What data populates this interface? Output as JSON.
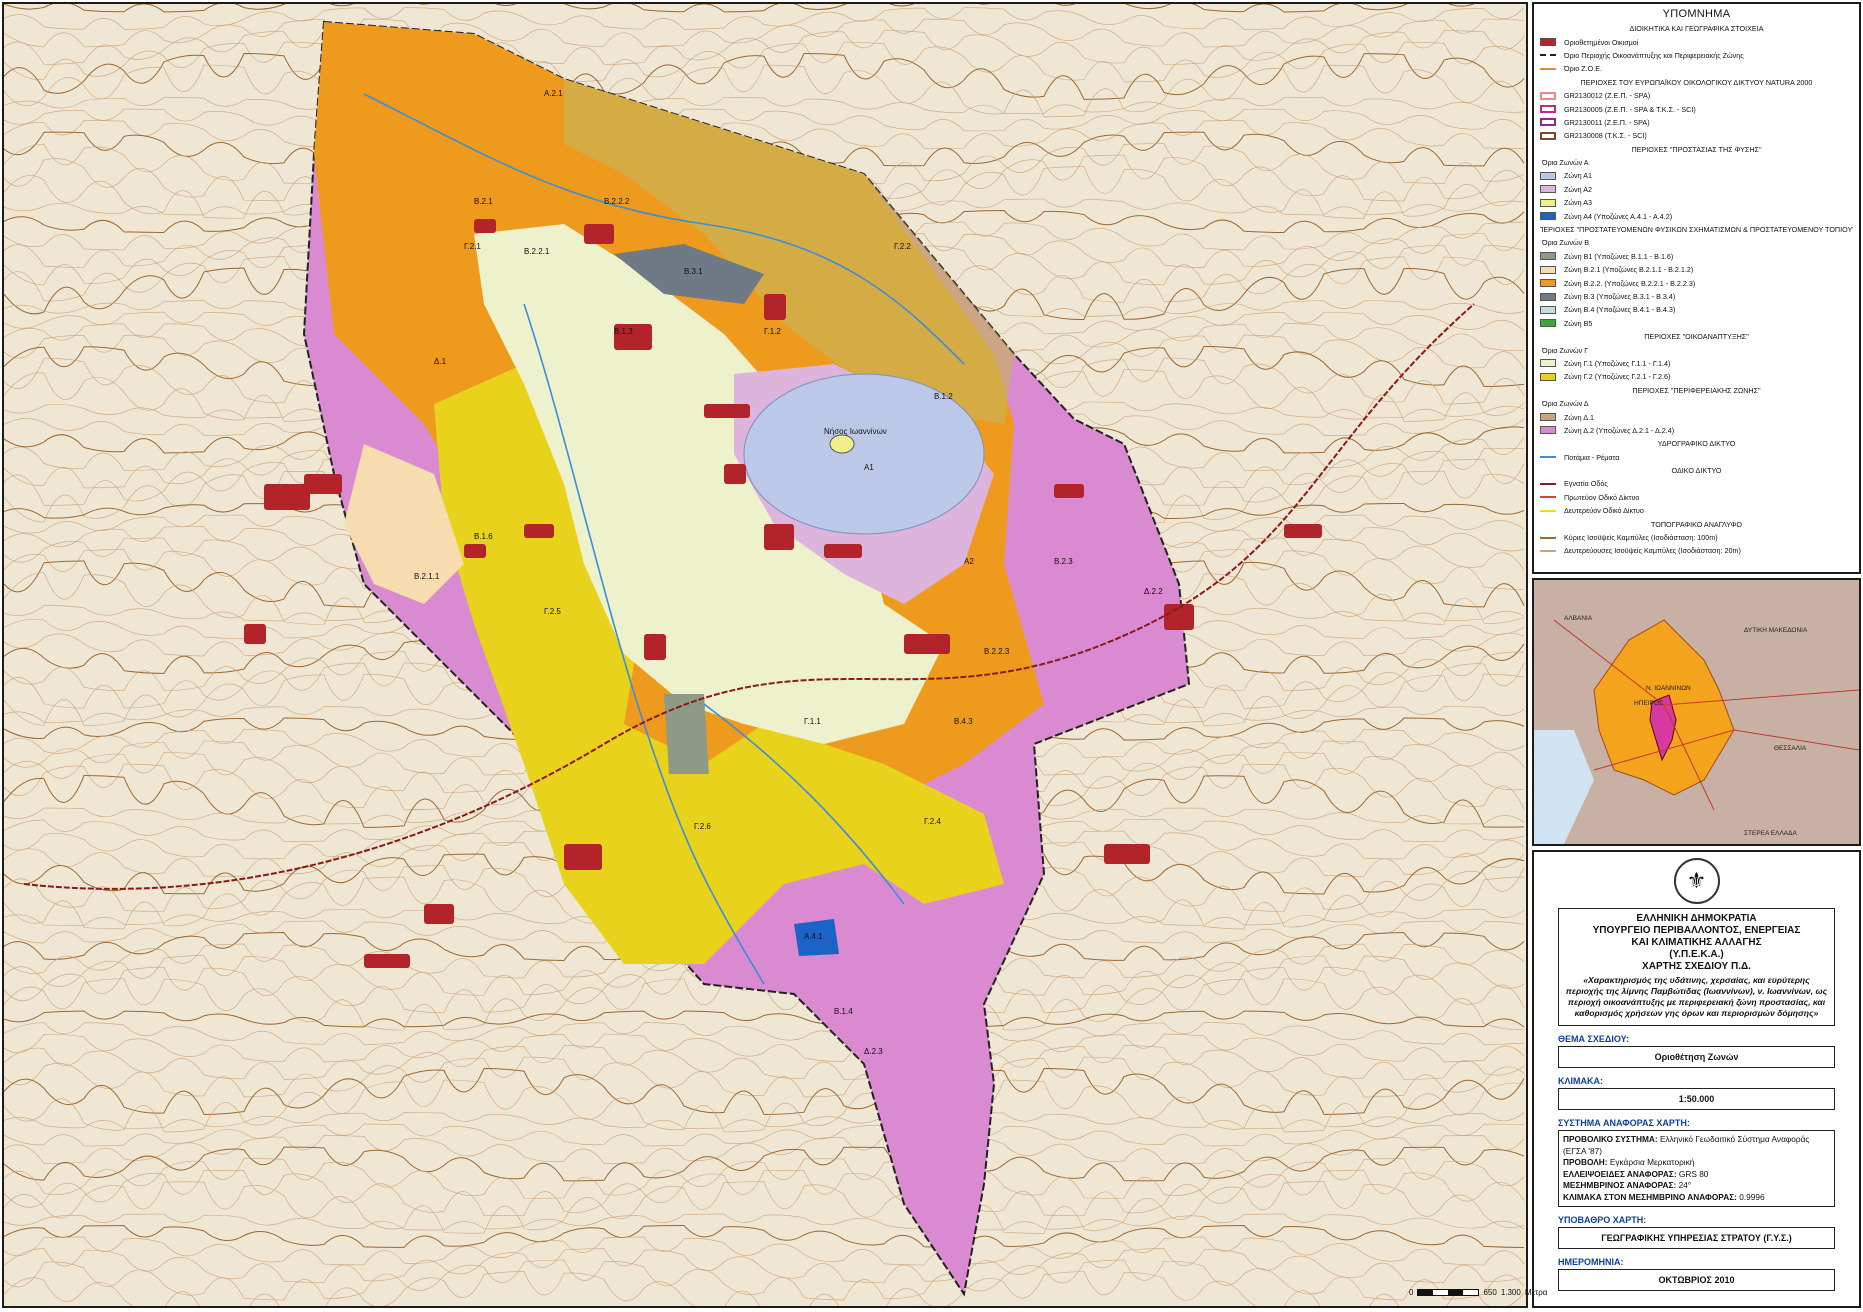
{
  "legend": {
    "title": "ΥΠΟΜΝΗΜΑ",
    "rows": [
      {
        "kind": "header",
        "text": "ΔΙΟΙΚΗΤΙΚΑ ΚΑΙ ΓΕΩΓΡΑΦΙΚΑ ΣΤΟΙΧΕΙΑ"
      },
      {
        "kind": "fill",
        "color": "#b3232a",
        "text": "Οριοθετημένοι Οικισμοί"
      },
      {
        "kind": "dashline",
        "color": "#222222",
        "text": "Όριο Περιοχής Οικοανάπτυξης και Περιφερειακής Ζώνης"
      },
      {
        "kind": "line",
        "color": "#e08a3c",
        "text": "Όριο Ζ.Ο.Ε."
      },
      {
        "kind": "header",
        "text": "ΠΕΡΙΟΧΕΣ ΤΟΥ ΕΥΡΩΠΑΪΚΟΥ ΟΙΚΟΛΟΓΙΚΟΥ ΔΙΚΤΥΟΥ NATURA 2000"
      },
      {
        "kind": "outline",
        "color": "#e88a8a",
        "text": "GR2130012 (Ζ.Ε.Π. - SPA)"
      },
      {
        "kind": "outline",
        "color": "#c02b86",
        "text": "GR2130005 (Ζ.Ε.Π. - SPA & Τ.Κ.Σ. - SCI)"
      },
      {
        "kind": "outline",
        "color": "#8a2b8f",
        "text": "GR2130011 (Ζ.Ε.Π. - SPA)"
      },
      {
        "kind": "outline",
        "color": "#7a4a2a",
        "text": "GR2130008 (Τ.Κ.Σ. - SCI)"
      },
      {
        "kind": "header",
        "text": "ΠΕΡΙΟΧΕΣ \"ΠΡΟΣΤΑΣΙΑΣ ΤΗΣ ΦΥΣΗΣ\""
      },
      {
        "kind": "sub",
        "text": "Όρια Ζωνών Α"
      },
      {
        "kind": "fill",
        "color": "#bcc8e8",
        "text": "Ζώνη Α1"
      },
      {
        "kind": "fill",
        "color": "#dcb4dc",
        "text": "Ζώνη Α2"
      },
      {
        "kind": "fill",
        "color": "#f2ee8a",
        "text": "Ζώνη Α3"
      },
      {
        "kind": "fill",
        "color": "#1b63c6",
        "text": "Ζώνη Α4 (Υποζώνες Α.4.1 - Α.4.2)"
      },
      {
        "kind": "header",
        "text": "ΠΕΡΙΟΧΕΣ \"ΠΡΟΣΤΑΤΕΥΟΜΕΝΩΝ ΦΥΣΙΚΩΝ ΣΧΗΜΑΤΙΣΜΩΝ & ΠΡΟΣΤΑΤΕΥΟΜΕΝΟΥ ΤΟΠΙΟΥ\""
      },
      {
        "kind": "sub",
        "text": "Όρια Ζωνών Β"
      },
      {
        "kind": "fill",
        "color": "#8e9a86",
        "text": "Ζώνη Β1 (Υποζώνες Β.1.1 - Β.1.6)"
      },
      {
        "kind": "fill",
        "color": "#f6dcae",
        "text": "Ζώνη Β.2.1 (Υποζώνες Β.2.1.1 - Β.2.1.2)"
      },
      {
        "kind": "fill",
        "color": "#ee9a1c",
        "text": "Ζώνη Β.2.2. (Υποζώνες Β.2.2.1 - Β.2.2.3)"
      },
      {
        "kind": "fill",
        "color": "#6f7a86",
        "text": "Ζώνη Β.3 (Υποζώνες Β.3.1 - Β.3.4)"
      },
      {
        "kind": "fill",
        "color": "#c6dde0",
        "text": "Ζώνη Β.4 (Υποζώνες Β.4.1 - Β.4.3)"
      },
      {
        "kind": "fill",
        "color": "#3aa83a",
        "text": "Ζώνη Β5"
      },
      {
        "kind": "header",
        "text": "ΠΕΡΙΟΧΕΣ \"ΟΙΚΟΑΝΑΠΤΥΞΗΣ\""
      },
      {
        "kind": "sub",
        "text": "Όρια Ζωνών Γ"
      },
      {
        "kind": "fill",
        "color": "#eef2cc",
        "text": "Ζώνη Γ.1 (Υποζώνες Γ.1.1 - Γ.1.4)"
      },
      {
        "kind": "fill",
        "color": "#e8d21c",
        "text": "Ζώνη Γ.2 (Υποζώνες Γ.2.1 - Γ.2.6)"
      },
      {
        "kind": "header",
        "text": "ΠΕΡΙΟΧΕΣ \"ΠΕΡΙΦΕΡΕΙΑΚΗΣ ΖΩΝΗΣ\""
      },
      {
        "kind": "sub",
        "text": "Όρια Ζωνών Δ"
      },
      {
        "kind": "fill",
        "color": "#c9a57a",
        "text": "Ζώνη Δ.1"
      },
      {
        "kind": "fill",
        "color": "#d98ad0",
        "text": "Ζώνη Δ.2 (Υποζώνες Δ.2.1 - Δ.2.4)"
      },
      {
        "kind": "header",
        "text": "ΥΔΡΟΓΡΑΦΙΚΟ ΔΙΚΤΥΟ"
      },
      {
        "kind": "line",
        "color": "#3b8fd9",
        "text": "Ποτάμια - Ρέματα"
      },
      {
        "kind": "header",
        "text": "ΟΔΙΚΟ ΔΙΚΤΥΟ"
      },
      {
        "kind": "line",
        "color": "#8a1a1a",
        "text": "Εγνατία Οδός"
      },
      {
        "kind": "line",
        "color": "#d9453a",
        "text": "Πρωτεύον Οδικό Δίκτυο"
      },
      {
        "kind": "line",
        "color": "#e6e21e",
        "text": "Δευτερεύον Οδικό Δίκτυο"
      },
      {
        "kind": "header",
        "text": "ΤΟΠΟΓΡΑΦΙΚΟ ΑΝΑΓΛΥΦΟ"
      },
      {
        "kind": "line",
        "color": "#9a6a32",
        "text": "Κύριες Ισοϋψείς Καμπύλες (Ισοδιάσταση: 100m)"
      },
      {
        "kind": "line",
        "color": "#c9a57a",
        "text": "Δευτερεύουσες Ισοϋψείς Καμπύλες (Ισοδιάσταση: 20m)"
      }
    ]
  },
  "inset": {
    "labels": [
      "ΑΛΒΑΝΙΑ",
      "ΔΥΤΙΚΗ ΜΑΚΕΔΟΝΙΑ",
      "Ν. ΙΩΑΝΝΙΝΩΝ",
      "ΗΠΕΙΡΟΣ",
      "ΘΕΣΣΑΛΙΑ",
      "ΣΤΕΡΕΑ ΕΛΛΑΔΑ"
    ],
    "colors": {
      "region": "#f4a31c",
      "prefecture": "#ee8a1c",
      "study_area": "#d63aa0",
      "background": "#c9b0a4",
      "sea": "#cfe3f2"
    }
  },
  "map": {
    "lake_label": "Α1",
    "island_label": "Νήσος Ιωαννίνων",
    "zone_labels": [
      "Α.2.1",
      "Β.2.1",
      "Β.2.2.1",
      "Γ.2.1",
      "Γ.2.2",
      "Β.2.2.2",
      "Β.3.1",
      "Β.1.3",
      "Γ.1.2",
      "Β.1.2",
      "Α2",
      "Β.2.3",
      "Δ.2.2",
      "Β.2.2.3",
      "Β.4.3",
      "Γ.1.1",
      "Γ.2.5",
      "Β.1.6",
      "Β.2.1.1",
      "Γ.2.6",
      "Δ.1",
      "Α.4.1",
      "Β.1.4",
      "Δ.2.3",
      "Γ.2.4"
    ],
    "colors": {
      "outer": "#c9a57a",
      "d2": "#d98ad0",
      "b22": "#ee9a1c",
      "g2": "#e8d21c",
      "g1": "#eef2cc",
      "a3": "#f2ee8a",
      "lake": "#bcc8e8",
      "b3": "#6f7a86",
      "b1": "#8e9a86",
      "b21": "#f6dcae",
      "a4": "#1b63c6",
      "settlement": "#b3232a",
      "river": "#3b8fd9",
      "road2": "#e6e21e",
      "egnatia": "#8a1a1a"
    }
  },
  "scale_bar": {
    "labels": [
      "0",
      "650",
      "1.300",
      "Μέτρα"
    ]
  },
  "title_block": {
    "emblem": "⚜",
    "lines": [
      "ΕΛΛΗΝΙΚΗ ΔΗΜΟΚΡΑΤΙΑ",
      "ΥΠΟΥΡΓΕΙΟ ΠΕΡΙΒΑΛΛΟΝΤΟΣ, ΕΝΕΡΓΕΙΑΣ",
      "ΚΑΙ ΚΛΙΜΑΤΙΚΗΣ ΑΛΛΑΓΗΣ",
      "(Υ.Π.Ε.Κ.Α.)",
      "ΧΑΡΤΗΣ ΣΧΕΔΙΟΥ Π.Δ."
    ],
    "description": "«Χαρακτηρισμός της υδάτινης, χερσαίας, και ευρύτερης περιοχής της λίμνης Παμβώτιδας (Ιωαννίνων), ν. Ιωαννίνων, ως περιοχή οικοανάπτυξης με περιφερειακή ζώνη προστασίας, και καθορισμός χρήσεων γης όρων και περιορισμών δόμησης»",
    "theme_label": "ΘΕΜΑ ΣΧΕΔΙΟΥ:",
    "theme_value": "Οριοθέτηση Ζωνών",
    "scale_label": "ΚΛΙΜΑΚΑ:",
    "scale_value": "1:50.000",
    "ref_label": "ΣΥΣΤΗΜΑ ΑΝΑΦΟΡΑΣ ΧΑΡΤΗ:",
    "ref_rows": [
      {
        "k": "ΠΡΟΒΟΛΙΚΟ ΣΥΣΤΗΜΑ:",
        "v": "Ελληνικό Γεωδαιτικό Σύστημα Αναφοράς (ΕΓΣΑ '87)"
      },
      {
        "k": "ΠΡΟΒΟΛΗ:",
        "v": "Εγκάρσια Μερκατορική"
      },
      {
        "k": "ΕΛΛΕΙΨΟΕΙΔΕΣ ΑΝΑΦΟΡΑΣ:",
        "v": "GRS 80"
      },
      {
        "k": "ΜΕΣΗΜΒΡΙΝΟΣ ΑΝΑΦΟΡΑΣ:",
        "v": "24°"
      },
      {
        "k": "ΚΛΙΜΑΚΑ ΣΤΟΝ ΜΕΣΗΜΒΡΙΝΟ ΑΝΑΦΟΡΑΣ:",
        "v": "0.9996"
      }
    ],
    "base_label": "ΥΠΟΒΑΘΡΟ ΧΑΡΤΗ:",
    "base_value": "ΓΕΩΓΡΑΦΙΚΗΣ ΥΠΗΡΕΣΙΑΣ ΣΤΡΑΤΟΥ (Γ.Υ.Σ.)",
    "date_label": "ΗΜΕΡΟΜΗΝΙΑ:",
    "date_value": "ΟΚΤΩΒΡΙΟΣ 2010"
  }
}
